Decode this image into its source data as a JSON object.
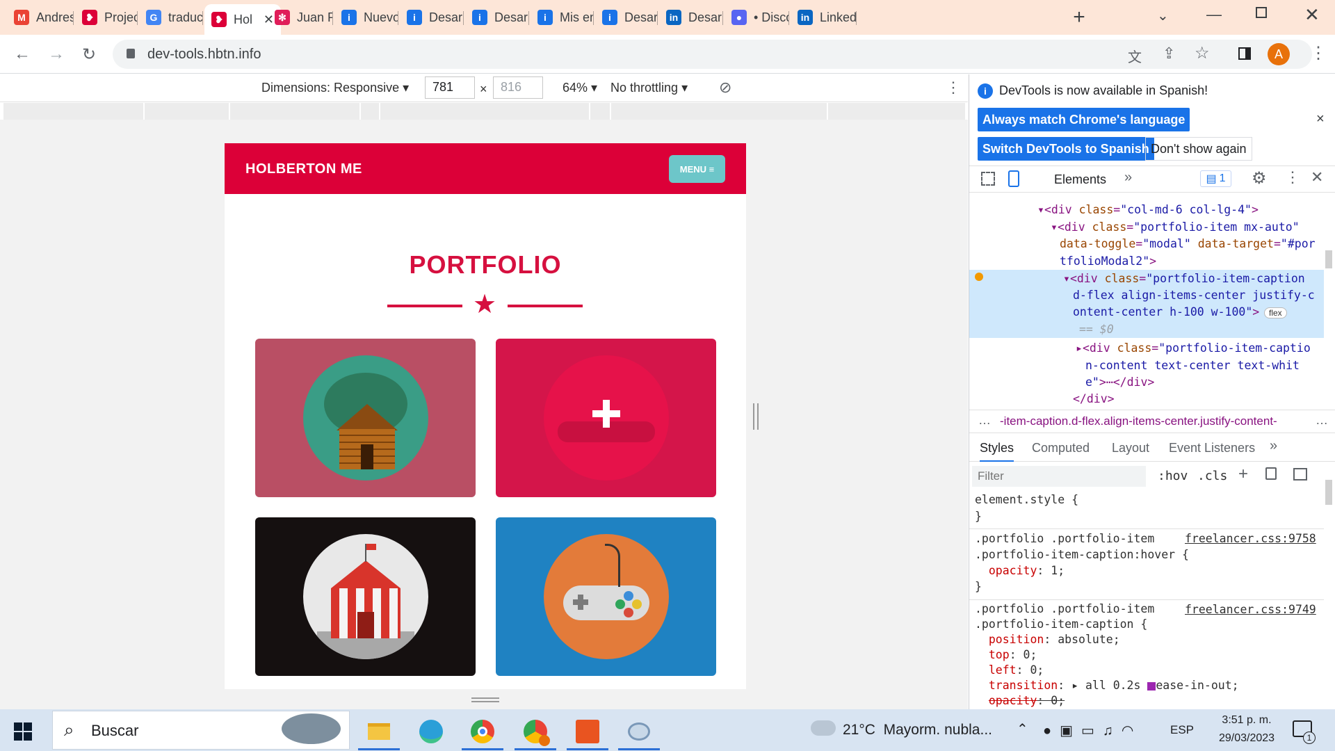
{
  "tabs": [
    {
      "title": "Andres",
      "icon": "gmail-icon",
      "color": "#ea4335",
      "glyph": "M"
    },
    {
      "title": "Project",
      "icon": "holberton-icon",
      "color": "#dc0038",
      "glyph": "❥"
    },
    {
      "title": "traducto",
      "icon": "google-icon",
      "color": "#4285f4",
      "glyph": "G"
    },
    {
      "title": "Hol",
      "icon": "holberton-icon",
      "color": "#dc0038",
      "glyph": "❥",
      "active": true
    },
    {
      "title": "Juan Pi",
      "icon": "slack-icon",
      "color": "#e01e5a",
      "glyph": "✻"
    },
    {
      "title": "Nuevo",
      "icon": "info-icon",
      "color": "#1a73e8",
      "glyph": "i"
    },
    {
      "title": "Desarro",
      "icon": "info-icon",
      "color": "#1a73e8",
      "glyph": "i"
    },
    {
      "title": "Desarro",
      "icon": "info-icon",
      "color": "#1a73e8",
      "glyph": "i"
    },
    {
      "title": "Mis em",
      "icon": "info-icon",
      "color": "#1a73e8",
      "glyph": "i"
    },
    {
      "title": "Desarro",
      "icon": "info-icon",
      "color": "#1a73e8",
      "glyph": "i"
    },
    {
      "title": "Desarro",
      "icon": "linkedin-icon",
      "color": "#0a66c2",
      "glyph": "in"
    },
    {
      "title": "• Disco",
      "icon": "discord-icon",
      "color": "#5865f2",
      "glyph": "●"
    },
    {
      "title": "LinkedI",
      "icon": "linkedin-icon",
      "color": "#0a66c2",
      "glyph": "in"
    }
  ],
  "url": "dev-tools.hbtn.info",
  "profile_initial": "A",
  "device_toolbar": {
    "dimensions_label": "Dimensions: Responsive",
    "width": "781",
    "times": "×",
    "height": "816",
    "zoom": "64%",
    "throttling": "No throttling"
  },
  "site": {
    "brand": "HOLBERTON ME",
    "menu": "MENU ≡",
    "section_title": "PORTFOLIO",
    "items": [
      {
        "name": "cabin",
        "bg": "#b94f64",
        "circle": "#3a9d86"
      },
      {
        "name": "cake",
        "bg": "#d4154a",
        "circle": "#e6124a"
      },
      {
        "name": "circus",
        "bg": "#151010",
        "circle": "#e8e8e8"
      },
      {
        "name": "game",
        "bg": "#1f82c2",
        "circle": "#e37b3a"
      }
    ]
  },
  "devtools": {
    "notice": "DevTools is now available in Spanish!",
    "btn_match": "Always match Chrome's language",
    "btn_switch": "Switch DevTools to Spanish",
    "btn_dont": "Don't show again",
    "tab_elements": "Elements",
    "issues_count": "1",
    "breadcrumb": "-item-caption.d-flex.align-items-center.justify-content-",
    "style_tabs": [
      "Styles",
      "Computed",
      "Layout",
      "Event Listeners"
    ],
    "filter_placeholder": "Filter",
    "hov": ":hov",
    "cls": ".cls",
    "flex_badge": "flex",
    "dom_ref": "== $0",
    "rule2_source": "freelancer.css:9758",
    "rule3_source": "freelancer.css:9749"
  },
  "taskbar": {
    "search_placeholder": "Buscar",
    "weather": "21°C  Mayorm. nubla...",
    "lang": "ESP",
    "time": "3:51 p. m.",
    "date": "29/03/2023",
    "notif_count": "1"
  }
}
